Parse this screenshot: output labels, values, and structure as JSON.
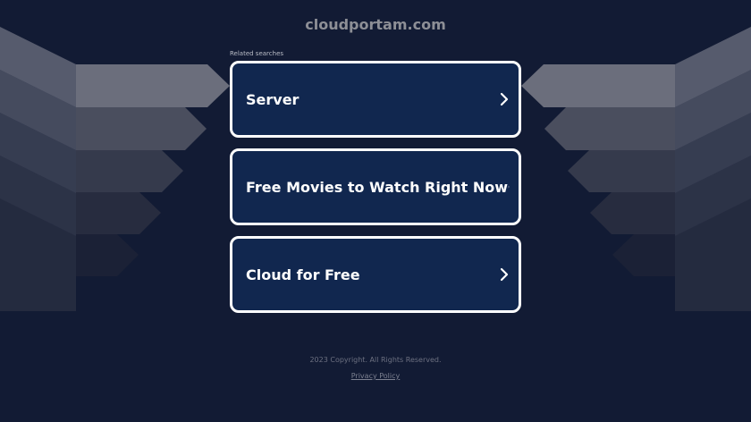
{
  "site": {
    "domain": "cloudportam.com"
  },
  "related": {
    "heading": "Related searches",
    "items": [
      {
        "label": "Server",
        "icon": "chevron-right-icon"
      },
      {
        "label": "Free Movies to Watch Right Now",
        "icon": "chevron-right-icon"
      },
      {
        "label": "Cloud for Free",
        "icon": "chevron-right-icon"
      }
    ]
  },
  "footer": {
    "copyright": "2023 Copyright. All Rights Reserved.",
    "privacy_link": "Privacy Policy"
  },
  "colors": {
    "background": "#121b34",
    "button_fill": "#11274f",
    "button_border": "#ffffff",
    "text": "#ffffff"
  }
}
